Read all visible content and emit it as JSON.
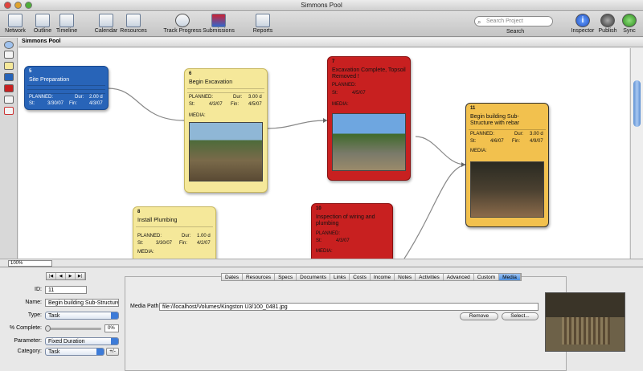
{
  "window": {
    "title": "Simmons Pool"
  },
  "toolbar": {
    "network": "Network",
    "outline": "Outline",
    "timeline": "Timeline",
    "calendar": "Calendar",
    "resources": "Resources",
    "track_progress": "Track Progress",
    "submissions": "Submissions",
    "reports": "Reports",
    "search_placeholder": "Search Project",
    "search_label": "Search",
    "inspector": "Inspector",
    "publish": "Publish",
    "sync": "Sync"
  },
  "doc_tab": "Simmons Pool",
  "zoom": "100%",
  "colors": {
    "blue": "#2864b8",
    "yellow": "#f5e89a",
    "red": "#c82020",
    "orange": "#f2c14e"
  },
  "cards": [
    {
      "num": "5",
      "name": "Site Preparation",
      "planned": "PLANNED:",
      "dur_l": "Dur:",
      "dur": "2.00 d",
      "st_l": "St:",
      "st": "3/30/07",
      "fin_l": "Fin:",
      "fin": "4/3/07"
    },
    {
      "num": "6",
      "name": "Begin Excavation",
      "planned": "PLANNED:",
      "dur_l": "Dur:",
      "dur": "3.00 d",
      "st_l": "St:",
      "st": "4/3/07",
      "fin_l": "Fin:",
      "fin": "4/5/07",
      "media": "MEDIA:"
    },
    {
      "num": "7",
      "name": "Excavation Complete, Topsoil Removed !",
      "planned": "PLANNED:",
      "st_l": "St:",
      "st": "4/5/07",
      "media": "MEDIA:"
    },
    {
      "num": "11",
      "name": "Begin building Sub-Structure with rebar",
      "planned": "PLANNED:",
      "dur_l": "Dur:",
      "dur": "3.00 d",
      "st_l": "St:",
      "st": "4/6/07",
      "fin_l": "Fin:",
      "fin": "4/9/07",
      "media": "MEDIA:"
    },
    {
      "num": "8",
      "name": "Install Plumbing",
      "planned": "PLANNED:",
      "dur_l": "Dur:",
      "dur": "1.00 d",
      "st_l": "St:",
      "st": "3/30/07",
      "fin_l": "Fin:",
      "fin": "4/2/07",
      "media": "MEDIA:"
    },
    {
      "num": "10",
      "name": "Inspection of wiring and plumbing",
      "planned": "PLANNED:",
      "st_l": "St:",
      "st": "4/3/07",
      "media": "MEDIA:"
    }
  ],
  "inspector": {
    "id_label": "ID:",
    "id": "11",
    "name_label": "Name:",
    "name": "Begin building Sub-Structure",
    "type_label": "Type:",
    "type": "Task",
    "complete_label": "% Complete:",
    "complete": "0%",
    "parameter_label": "Parameter:",
    "parameter": "Fixed Duration",
    "category_label": "Category:",
    "category": "Task",
    "plusminus": "+/-",
    "tabs": [
      "Dates",
      "Resources",
      "Specs",
      "Documents",
      "Links",
      "Costs",
      "Income",
      "Notes",
      "Activities",
      "Advanced",
      "Custom",
      "Media"
    ],
    "active_tab": "Media",
    "media_path_label": "Media Path:",
    "media_path": "file://localhost/Volumes/Kingston U3/100_0481.jpg",
    "remove": "Remove",
    "select": "Select..."
  }
}
